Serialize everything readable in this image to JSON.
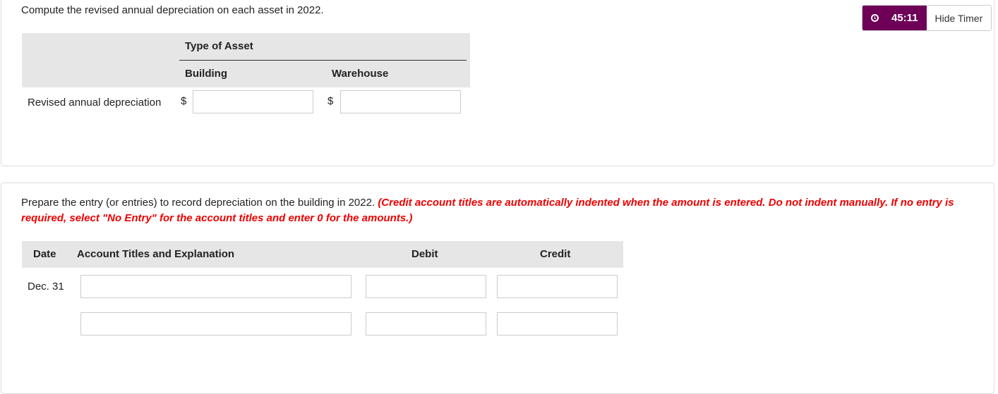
{
  "timer": {
    "time": "45:11",
    "hide_label": "Hide Timer",
    "icon": "clock-icon",
    "color": "#6e0058"
  },
  "part1": {
    "instruction": "Compute the revised annual depreciation on each asset in 2022.",
    "group_header": "Type of Asset",
    "columns": [
      "Building",
      "Warehouse"
    ],
    "row_label": "Revised annual depreciation",
    "currency": "$",
    "values": [
      "",
      ""
    ]
  },
  "part2": {
    "instruction": "Prepare the entry (or entries) to record depreciation on the building in 2022.",
    "note": "(Credit account titles are automatically indented when the amount is entered. Do not indent manually. If no entry is required, select \"No Entry\" for the account titles and enter 0 for the amounts.)",
    "headers": {
      "date": "Date",
      "account": "Account Titles and Explanation",
      "debit": "Debit",
      "credit": "Credit"
    },
    "rows": [
      {
        "date": "Dec. 31",
        "account": "",
        "debit": "",
        "credit": ""
      },
      {
        "date": "",
        "account": "",
        "debit": "",
        "credit": ""
      }
    ]
  }
}
